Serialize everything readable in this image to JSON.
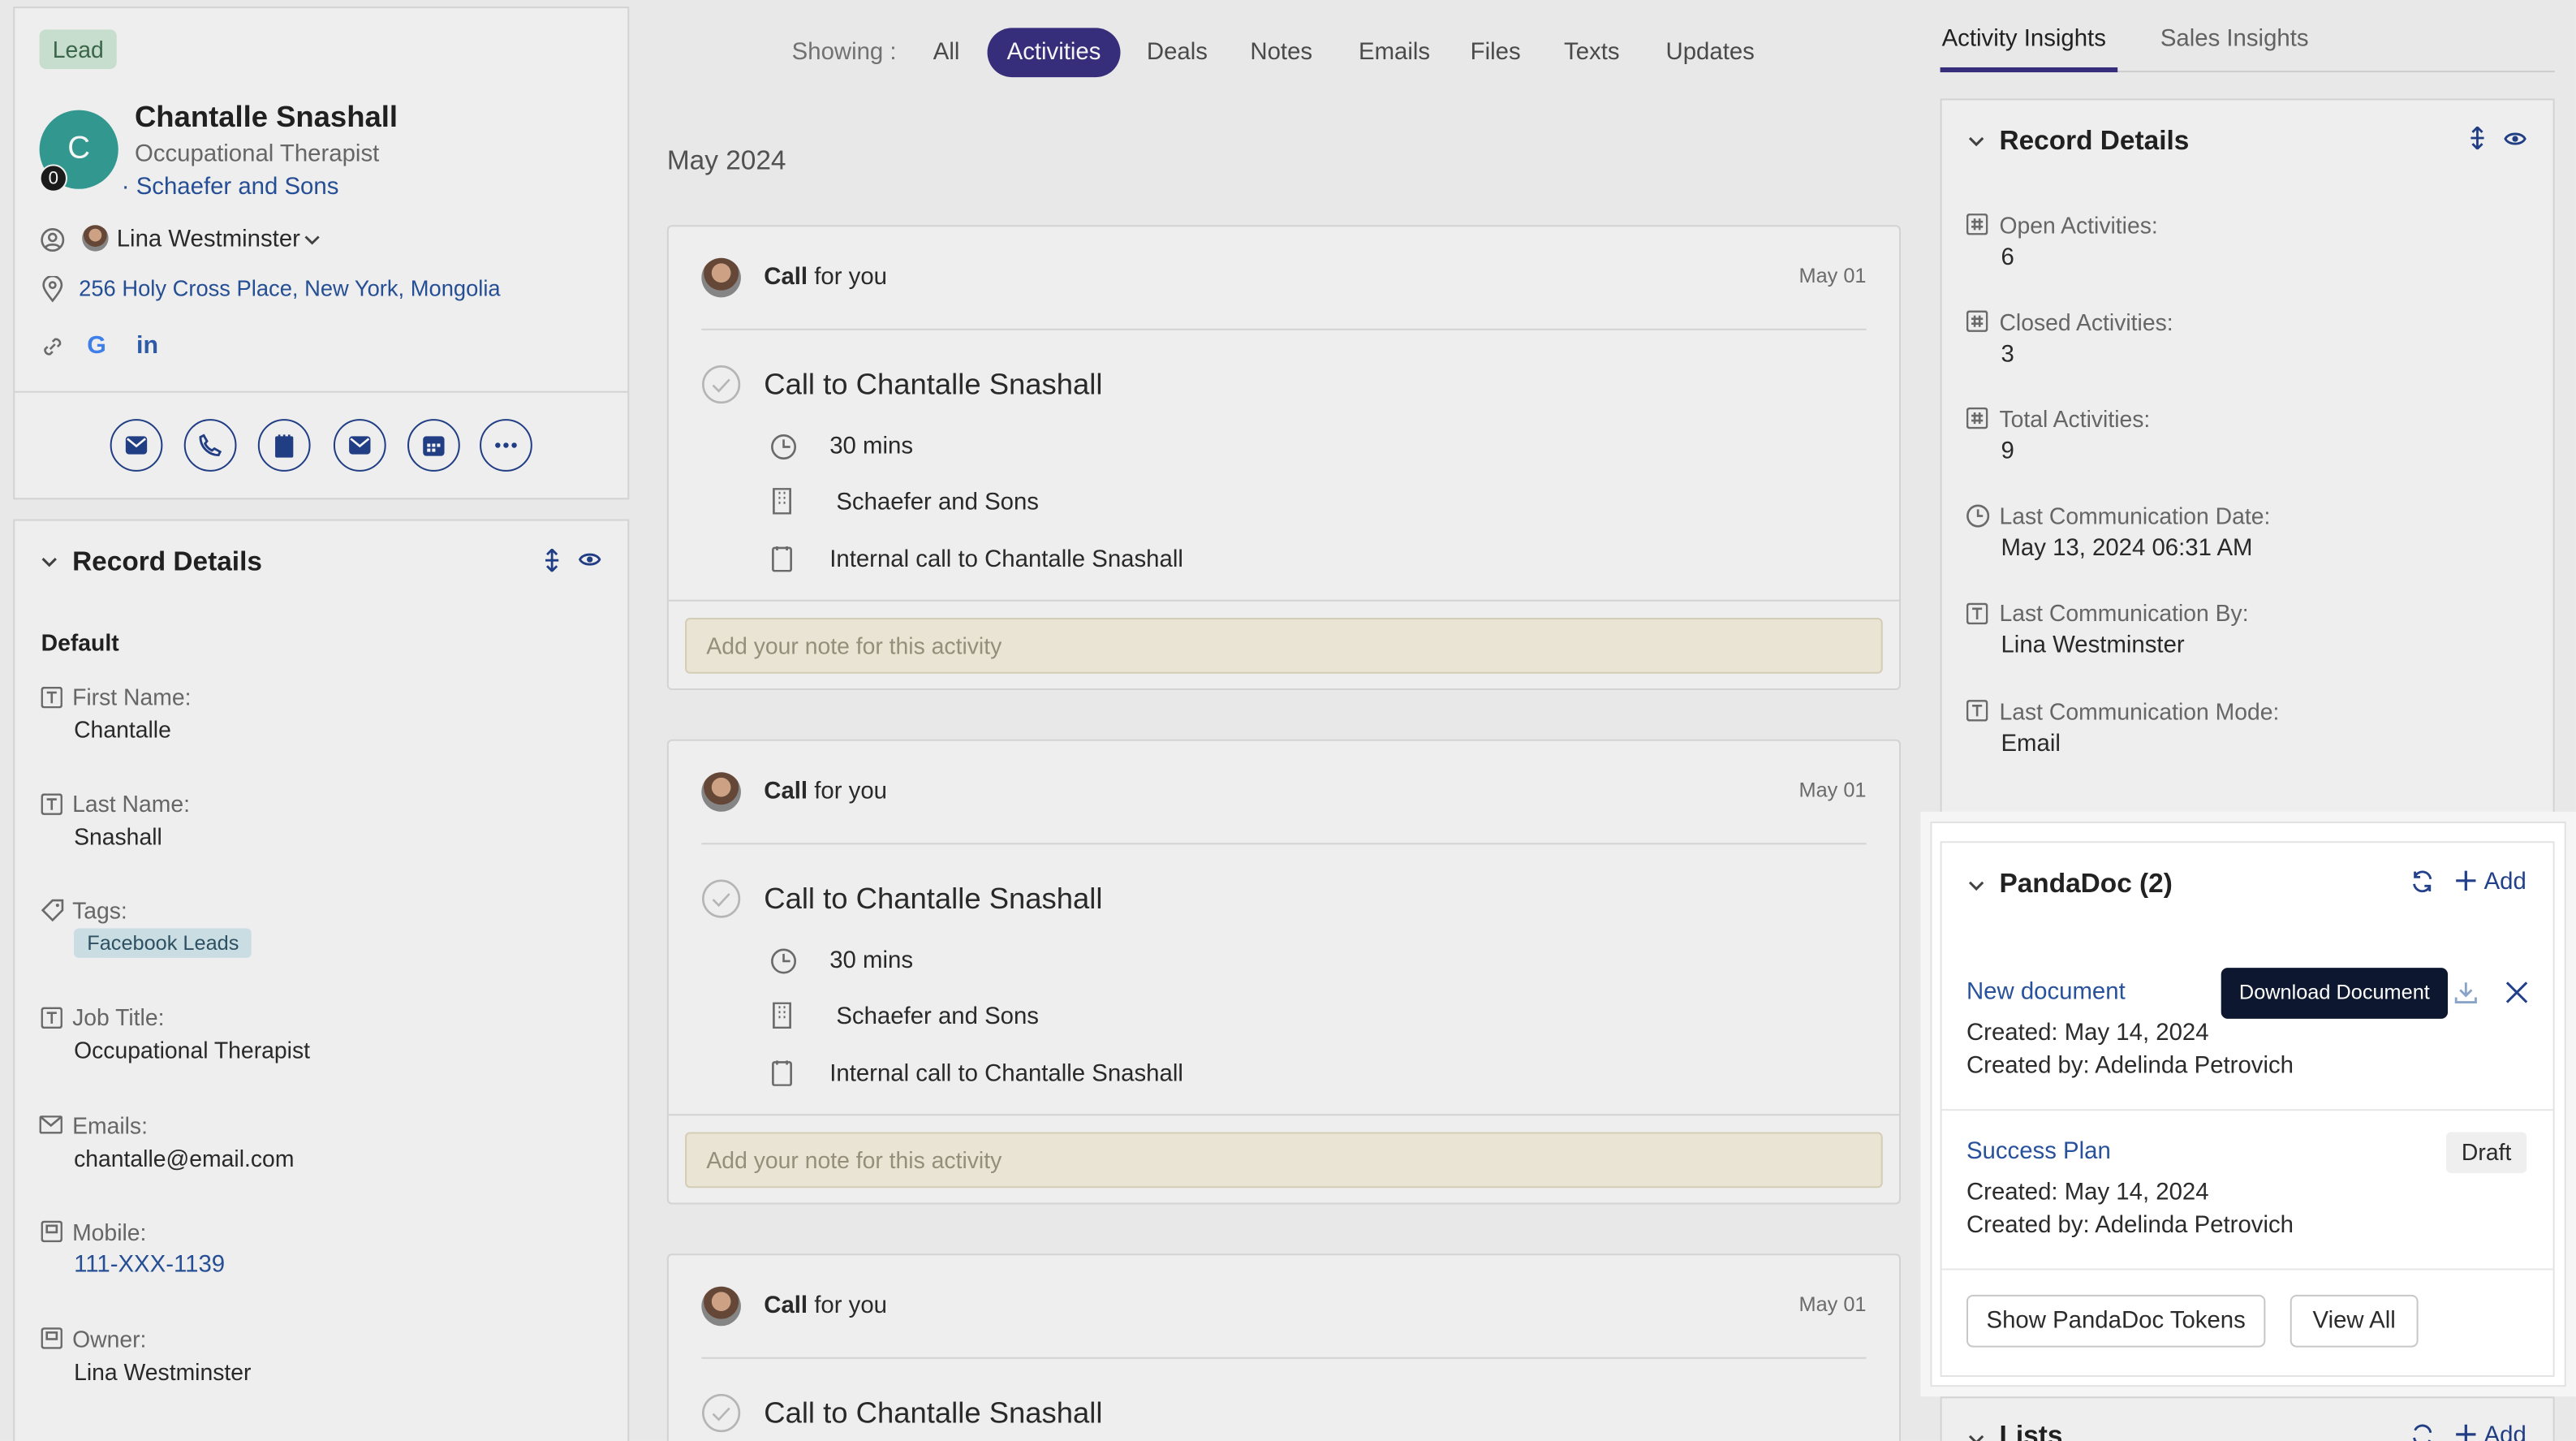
{
  "profile": {
    "badge": "Lead",
    "avatar_initial": "C",
    "avatar_count": "0",
    "name": "Chantalle Snashall",
    "title": "Occupational Therapist",
    "company": "· Schaefer and Sons",
    "owner": "Lina Westminster",
    "address": "256 Holy Cross Place, New York, Mongolia"
  },
  "left_details": {
    "header": "Record Details",
    "section": "Default",
    "fields": [
      {
        "label": "First Name:",
        "value": "Chantalle"
      },
      {
        "label": "Last Name:",
        "value": "Snashall"
      },
      {
        "label": "Tags:",
        "value": "Facebook Leads"
      },
      {
        "label": "Job Title:",
        "value": "Occupational Therapist"
      },
      {
        "label": "Emails:",
        "value": "chantalle@email.com"
      },
      {
        "label": "Mobile:",
        "value": "111-XXX-1139"
      },
      {
        "label": "Owner:",
        "value": "Lina Westminster"
      }
    ]
  },
  "filters": {
    "showing_label": "Showing :",
    "items": [
      "All",
      "Activities",
      "Deals",
      "Notes",
      "Emails",
      "Files",
      "Texts",
      "Updates"
    ]
  },
  "timeline": {
    "month": "May 2024",
    "activities": [
      {
        "head_bold": "Call",
        "head_rest": " for you",
        "date": "May 01",
        "title": "Call to Chantalle Snashall",
        "duration": "30 mins",
        "company": "Schaefer and Sons",
        "description": "Internal call to Chantalle Snashall",
        "note_placeholder": "Add your note for this activity"
      },
      {
        "head_bold": "Call",
        "head_rest": " for you",
        "date": "May 01",
        "title": "Call to Chantalle Snashall",
        "duration": "30 mins",
        "company": "Schaefer and Sons",
        "description": "Internal call to Chantalle Snashall",
        "note_placeholder": "Add your note for this activity"
      },
      {
        "head_bold": "Call",
        "head_rest": " for you",
        "date": "May 01",
        "title": "Call to Chantalle Snashall"
      }
    ]
  },
  "right": {
    "tabs": [
      "Activity Insights",
      "Sales Insights"
    ],
    "record_header": "Record Details",
    "fields": [
      {
        "label": "Open Activities:",
        "value": "6"
      },
      {
        "label": "Closed Activities:",
        "value": "3"
      },
      {
        "label": "Total Activities:",
        "value": "9"
      },
      {
        "label": "Last Communication Date:",
        "value": "May 13, 2024 06:31 AM"
      },
      {
        "label": "Last Communication By:",
        "value": "Lina Westminster"
      },
      {
        "label": "Last Communication Mode:",
        "value": "Email"
      }
    ],
    "pandadoc": {
      "header": "PandaDoc (2)",
      "add_label": "Add",
      "tooltip": "Download Document",
      "docs": [
        {
          "name": "New document",
          "created": "Created: May 14, 2024",
          "created_by": "Created by: Adelinda Petrovich"
        },
        {
          "name": "Success Plan",
          "status": "Draft",
          "created": "Created: May 14, 2024",
          "created_by": "Created by: Adelinda Petrovich"
        }
      ],
      "show_tokens": "Show PandaDoc Tokens",
      "view_all": "View All"
    },
    "lists_header": "Lists"
  },
  "colors": {
    "accent": "#3a3080",
    "link": "#27529b",
    "avatar": "#359e95",
    "tooltip": "#0e1730"
  }
}
